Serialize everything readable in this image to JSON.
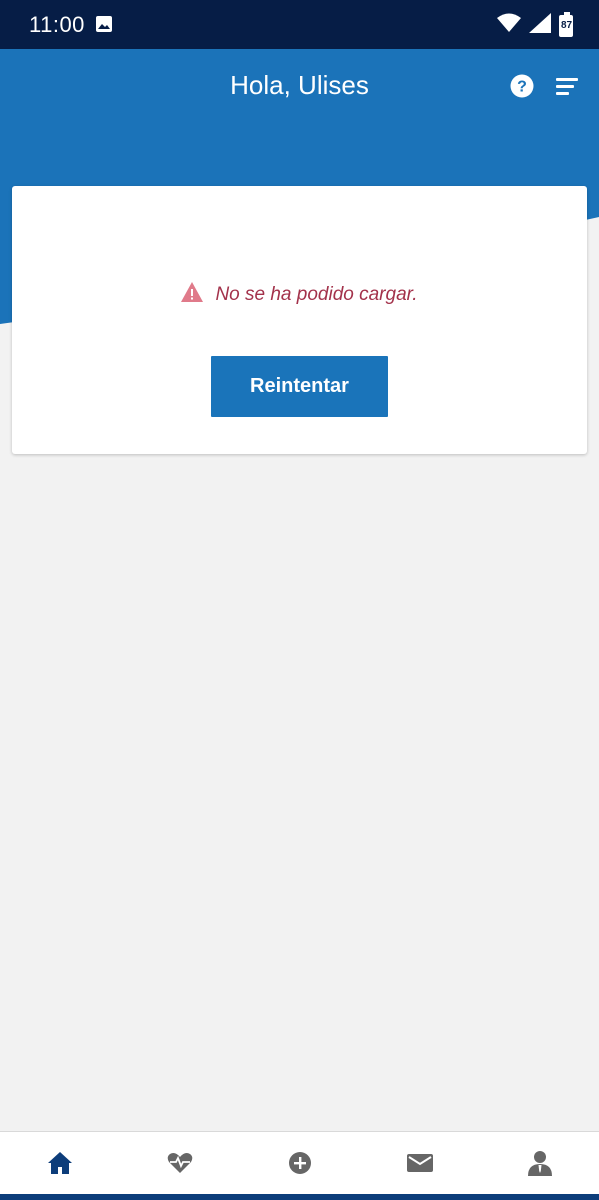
{
  "status_bar": {
    "time": "11:00",
    "battery_level": "87",
    "icons": [
      "image-icon",
      "wifi-icon",
      "signal-icon",
      "battery-icon"
    ]
  },
  "header": {
    "greeting": "Hola, Ulises",
    "icons": [
      "help-icon",
      "menu-icon"
    ]
  },
  "error_card": {
    "message": "No se ha podido cargar.",
    "retry_label": "Reintentar"
  },
  "bottom_nav": {
    "items": [
      {
        "icon": "home-icon",
        "active": true
      },
      {
        "icon": "heart-pulse-icon",
        "active": false
      },
      {
        "icon": "plus-circle-icon",
        "active": false
      },
      {
        "icon": "mail-icon",
        "active": false
      },
      {
        "icon": "profile-icon",
        "active": false
      }
    ]
  },
  "colors": {
    "status_bar": "#061d46",
    "header_blue": "#1b73b9",
    "error_text": "#a3324b",
    "warning_icon": "#e07a8a",
    "button_blue": "#1a74ba",
    "nav_active": "#0d3d7a",
    "nav_inactive": "#666666",
    "background": "#f2f2f2"
  }
}
